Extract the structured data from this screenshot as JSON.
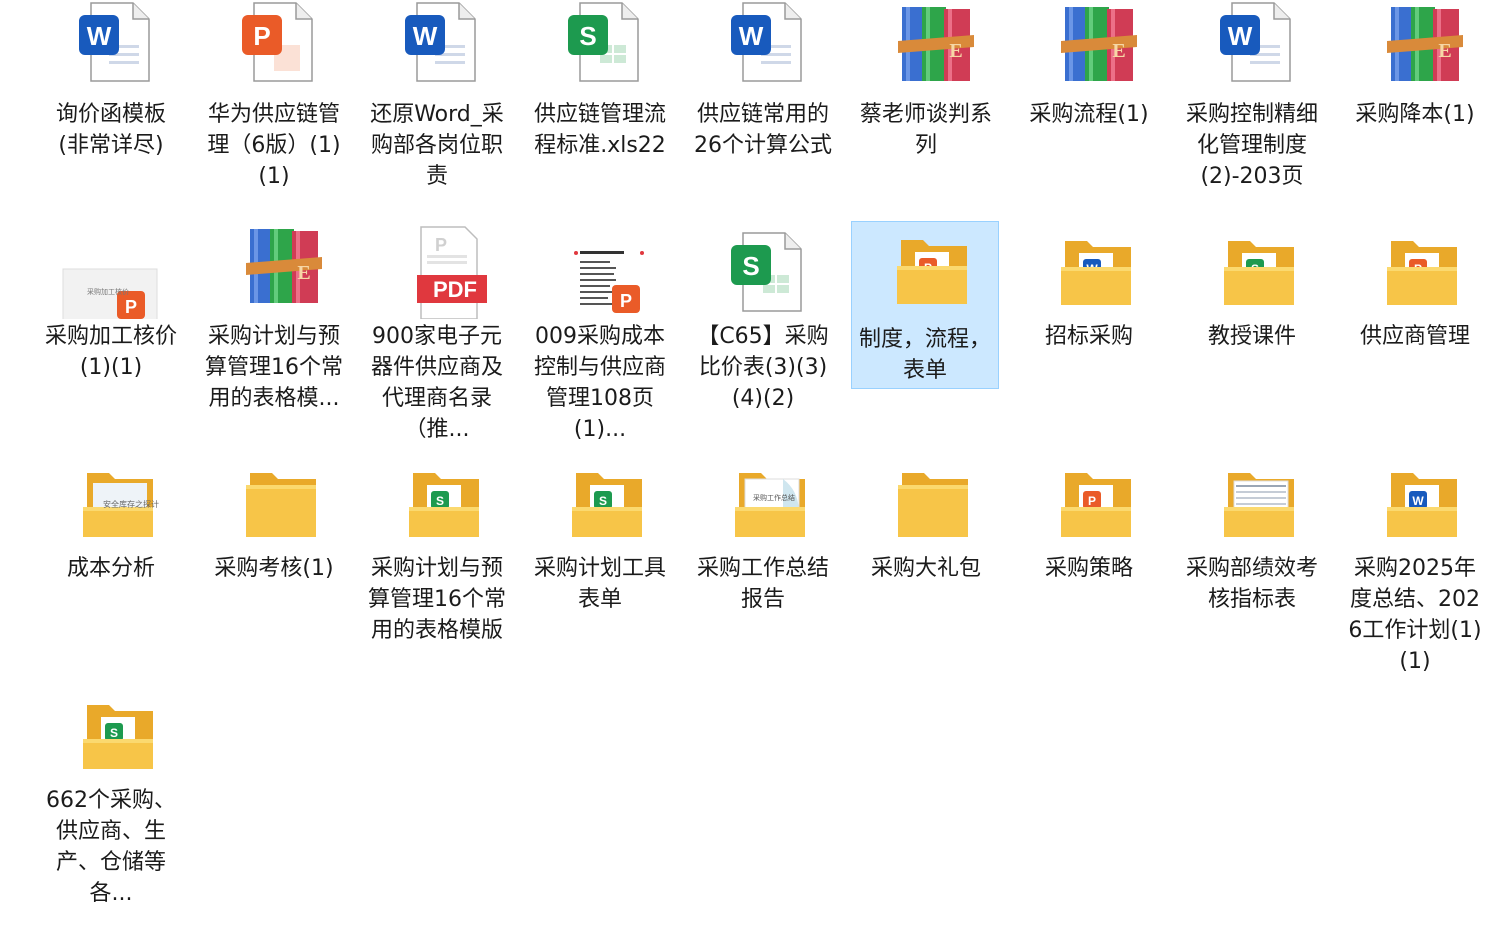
{
  "items": [
    {
      "label": "询价函模板(非常详尽)",
      "icon": "word-file-icon"
    },
    {
      "label": "华为供应链管理（6版）(1)(1)",
      "icon": "powerpoint-file-icon"
    },
    {
      "label": "还原Word_采购部各岗位职责",
      "icon": "word-file-icon"
    },
    {
      "label": "供应链管理流程标准.xls22",
      "icon": "spreadsheet-file-icon"
    },
    {
      "label": "供应链常用的26个计算公式",
      "icon": "word-file-icon"
    },
    {
      "label": "蔡老师谈判系列",
      "icon": "winrar-archive-icon"
    },
    {
      "label": "采购流程(1)",
      "icon": "winrar-archive-icon"
    },
    {
      "label": "采购控制精细化管理制度 (2)-203页",
      "icon": "word-file-icon"
    },
    {
      "label": "采购降本(1)",
      "icon": "winrar-archive-icon"
    },
    {
      "label": "采购加工核价(1)(1)",
      "icon": "ppt-thumbnail-icon"
    },
    {
      "label": "采购计划与预算管理16个常用的表格模...",
      "icon": "winrar-archive-icon"
    },
    {
      "label": "900家电子元器件供应商及代理商名录（推...",
      "icon": "pdf-file-icon"
    },
    {
      "label": "009采购成本控制与供应商管理108页(1)...",
      "icon": "document-thumbnail-icon"
    },
    {
      "label": "【C65】采购比价表(3)(3)(4)(2)",
      "icon": "spreadsheet-file-icon"
    },
    {
      "label": "制度，流程，表单",
      "icon": "folder-ppt-icon"
    },
    {
      "label": "招标采购",
      "icon": "folder-word-icon"
    },
    {
      "label": "教授课件",
      "icon": "folder-sheet-icon"
    },
    {
      "label": "供应商管理",
      "icon": "folder-ppt-icon"
    },
    {
      "label": "成本分析",
      "icon": "folder-document-icon"
    },
    {
      "label": "采购考核(1)",
      "icon": "folder-icon"
    },
    {
      "label": "采购计划与预算管理16个常用的表格模版",
      "icon": "folder-sheet-icon"
    },
    {
      "label": "采购计划工具表单",
      "icon": "folder-sheet-icon"
    },
    {
      "label": "采购工作总结报告",
      "icon": "folder-document-icon"
    },
    {
      "label": "采购大礼包",
      "icon": "folder-icon"
    },
    {
      "label": "采购策略",
      "icon": "folder-ppt-icon"
    },
    {
      "label": "采购部绩效考核指标表",
      "icon": "folder-table-icon"
    },
    {
      "label": "采购2025年度总结、2026工作计划(1)(1)",
      "icon": "folder-word-icon"
    },
    {
      "label": "662个采购、供应商、生产、仓储等各...",
      "icon": "folder-sheet-icon"
    }
  ],
  "selected_index": 14,
  "thumbnail_text": {
    "ppt_thumb": "采购加工核价",
    "folder_doc_a": "安全库存之探计",
    "folder_doc_b": "采购工作总结"
  },
  "colors": {
    "word": "#185abd",
    "powerpoint": "#ea5b28",
    "sheet": "#1d9a4f",
    "pdf": "#e0383e",
    "folder": "#f7c548",
    "selection": "#cce8ff"
  }
}
